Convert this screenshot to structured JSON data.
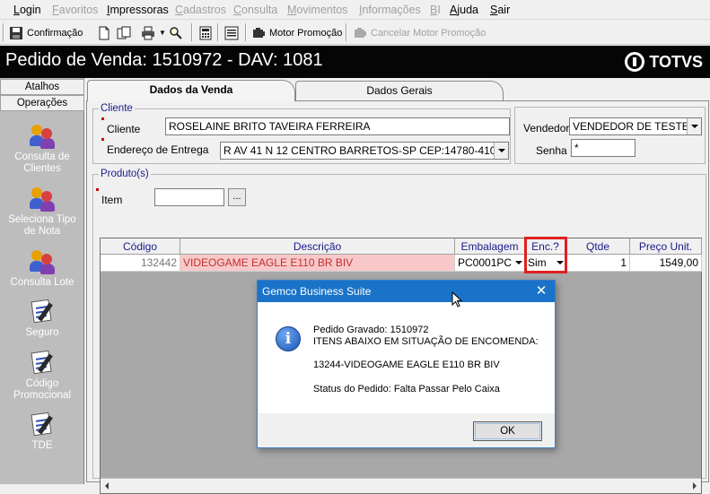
{
  "menubar": {
    "items": [
      {
        "label": "Login",
        "enabled": true
      },
      {
        "label": "Favoritos",
        "enabled": false
      },
      {
        "label": "Impressoras",
        "enabled": true
      },
      {
        "label": "Cadastros",
        "enabled": false
      },
      {
        "label": "Consulta",
        "enabled": false
      },
      {
        "label": "Movimentos",
        "enabled": false
      },
      {
        "label": "Informações",
        "enabled": false
      },
      {
        "label": "BI",
        "enabled": false
      },
      {
        "label": "Ajuda",
        "enabled": true
      },
      {
        "label": "Sair",
        "enabled": true
      }
    ]
  },
  "toolbar": {
    "confirm_label": "Confirmação",
    "motor_label": "Motor Promoção",
    "cancel_motor_label": "Cancelar Motor Promoção"
  },
  "header": {
    "title": "Pedido de Venda: 1510972  - DAV: 1081",
    "brand": "TOTVS"
  },
  "sidebar": {
    "sections": [
      "Atalhos",
      "Operações"
    ],
    "items": [
      {
        "label": "Consulta de Clientes",
        "icon": "clients-icon"
      },
      {
        "label": "Seleciona Tipo de Nota",
        "icon": "clients-icon"
      },
      {
        "label": "Consulta Lote",
        "icon": "clients-icon"
      },
      {
        "label": "Seguro",
        "icon": "document-pen-icon"
      },
      {
        "label": "Código Promocional",
        "icon": "document-pen-icon"
      },
      {
        "label": "TDE",
        "icon": "document-pen-icon"
      }
    ]
  },
  "tabs": [
    {
      "label": "Dados da Venda",
      "active": true
    },
    {
      "label": "Dados Gerais",
      "active": false
    }
  ],
  "cliente_group": {
    "legend": "Cliente",
    "cliente_label": "Cliente",
    "cliente_value": "ROSELAINE BRITO TAVEIRA FERREIRA",
    "endereco_label": "Endereço de Entrega",
    "endereco_value": "R  AV 41 N 12 CENTRO BARRETOS-SP CEP:14780-410"
  },
  "vendedor_group": {
    "vendedor_label": "Vendedor",
    "vendedor_value": "VENDEDOR DE TESTE",
    "senha_label": "Senha",
    "senha_value": "*"
  },
  "produtos_group": {
    "legend": "Produto(s)",
    "item_label": "Item",
    "item_value": "",
    "browse_label": "..."
  },
  "grid": {
    "columns": [
      "Código",
      "Descrição",
      "Embalagem",
      "Enc.?",
      "Qtde",
      "Preço Unit."
    ],
    "rows": [
      {
        "codigo": "132442",
        "descricao": "VIDEOGAME EAGLE E110 BR BIV",
        "embalagem": "PC0001PC",
        "enc": "Sim",
        "qtde": "1",
        "preco": "1549,00"
      }
    ]
  },
  "dialog": {
    "title": "Gemco Business Suite",
    "close_label": "✕",
    "lines": [
      "Pedido Gravado: 1510972",
      "ITENS ABAIXO EM SITUAÇÃO DE ENCOMENDA:",
      "13244-VIDEOGAME EAGLE E110 BR BIV",
      "Status do Pedido: Falta Passar Pelo Caixa"
    ],
    "ok_label": "OK"
  },
  "colors": {
    "title_bar": "#050505",
    "sidebar_bg": "#bdbdbd",
    "dialog_titlebar": "#1a73c8",
    "highlight_box": "#e02020",
    "row_pink": "#f8c8c8"
  }
}
